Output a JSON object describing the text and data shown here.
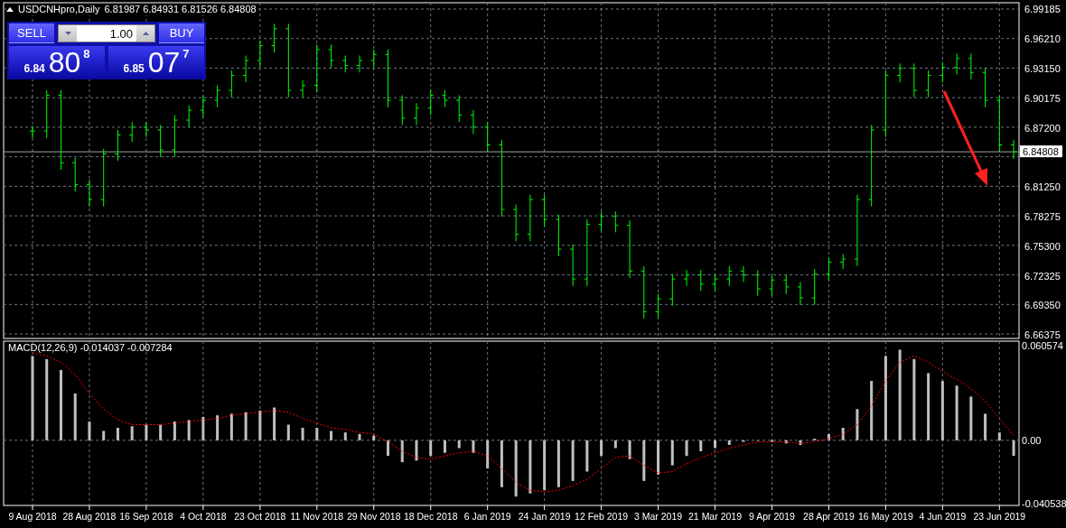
{
  "chart_header": {
    "symbol": "USDCNHpro,Daily",
    "quote": "6.81987 6.84931 6.81526 6.84808"
  },
  "trade_panel": {
    "sell_label": "SELL",
    "buy_label": "BUY",
    "lot": "1.00",
    "sell_price": {
      "prefix": "6.84",
      "pips": "80",
      "fraction": "8"
    },
    "buy_price": {
      "prefix": "6.85",
      "pips": "07",
      "fraction": "7"
    }
  },
  "price_chart": {
    "axis_labels": [
      "6.99185",
      "6.96210",
      "6.93150",
      "6.90175",
      "6.87200",
      "6.81250",
      "6.78275",
      "6.75300",
      "6.72325",
      "6.69350",
      "6.66375"
    ],
    "current_price_label": "6.84808"
  },
  "macd": {
    "label": "MACD(12,26,9) -0.014037 -0.007284",
    "chart_data": {
      "type": "bar",
      "grid": true,
      "ylim": [
        -0.040538,
        0.060574
      ],
      "yticks": [
        {
          "value": 0.060574,
          "label": "0.060574"
        },
        {
          "value": 0,
          "label": "0.00"
        },
        {
          "value": -0.040538,
          "label": "-0.040538"
        }
      ],
      "categories": [
        "9 Aug 2018",
        null,
        null,
        null,
        "28 Aug 2018",
        null,
        null,
        null,
        "16 Sep 2018",
        null,
        null,
        null,
        "4 Oct 2018",
        null,
        null,
        null,
        "23 Oct 2018",
        null,
        null,
        null,
        "11 Nov 2018",
        null,
        null,
        null,
        "29 Nov 2018",
        null,
        null,
        null,
        "18 Dec 2018",
        null,
        null,
        null,
        "6 Jan 2019",
        null,
        null,
        null,
        "24 Jan 2019",
        null,
        null,
        null,
        "12 Feb 2019",
        null,
        null,
        null,
        "3 Mar 2019",
        null,
        null,
        null,
        "21 Mar 2019",
        null,
        null,
        null,
        "9 Apr 2019",
        null,
        null,
        null,
        "28 Apr 2019",
        null,
        null,
        null,
        "16 May 2019",
        null,
        null,
        null,
        "4 Jun 2019",
        null,
        null,
        null,
        "23 Jun 2019",
        null
      ],
      "series": [
        {
          "color": "#c0c0c0",
          "values": [
            0.054,
            0.052,
            0.045,
            0.03,
            0.012,
            0.006,
            0.008,
            0.009,
            0.01,
            0.01,
            0.012,
            0.013,
            0.015,
            0.016,
            0.017,
            0.018,
            0.019,
            0.021,
            0.01,
            0.008,
            0.008,
            0.006,
            0.005,
            0.004,
            0.003,
            -0.01,
            -0.014,
            -0.013,
            -0.01,
            -0.008,
            -0.005,
            -0.008,
            -0.018,
            -0.03,
            -0.036,
            -0.034,
            -0.032,
            -0.03,
            -0.026,
            -0.02,
            -0.01,
            -0.005,
            -0.012,
            -0.026,
            -0.022,
            -0.016,
            -0.01,
            -0.007,
            -0.005,
            -0.003,
            -0.001,
            0,
            -0.001,
            -0.002,
            -0.003,
            0.001,
            0.004,
            0.008,
            0.02,
            0.038,
            0.054,
            0.058,
            0.052,
            0.043,
            0.038,
            0.035,
            0.028,
            0.017,
            0.005,
            -0.01
          ]
        },
        {
          "type": "line",
          "line_style": "dashed",
          "color": "#ff0000",
          "values": [
            0.056,
            0.054,
            0.05,
            0.042,
            0.03,
            0.02,
            0.013,
            0.01,
            0.01,
            0.01,
            0.011,
            0.012,
            0.013,
            0.014,
            0.016,
            0.017,
            0.018,
            0.019,
            0.018,
            0.014,
            0.011,
            0.008,
            0.007,
            0.005,
            0.004,
            -0.001,
            -0.007,
            -0.011,
            -0.012,
            -0.01,
            -0.008,
            -0.007,
            -0.01,
            -0.018,
            -0.027,
            -0.032,
            -0.033,
            -0.032,
            -0.029,
            -0.025,
            -0.018,
            -0.011,
            -0.01,
            -0.016,
            -0.021,
            -0.02,
            -0.015,
            -0.011,
            -0.008,
            -0.005,
            -0.003,
            -0.001,
            -0.001,
            -0.001,
            -0.002,
            -0.001,
            0.001,
            0.004,
            0.01,
            0.022,
            0.038,
            0.05,
            0.054,
            0.05,
            0.044,
            0.039,
            0.033,
            0.025,
            0.014,
            0.003
          ]
        }
      ]
    }
  }
}
